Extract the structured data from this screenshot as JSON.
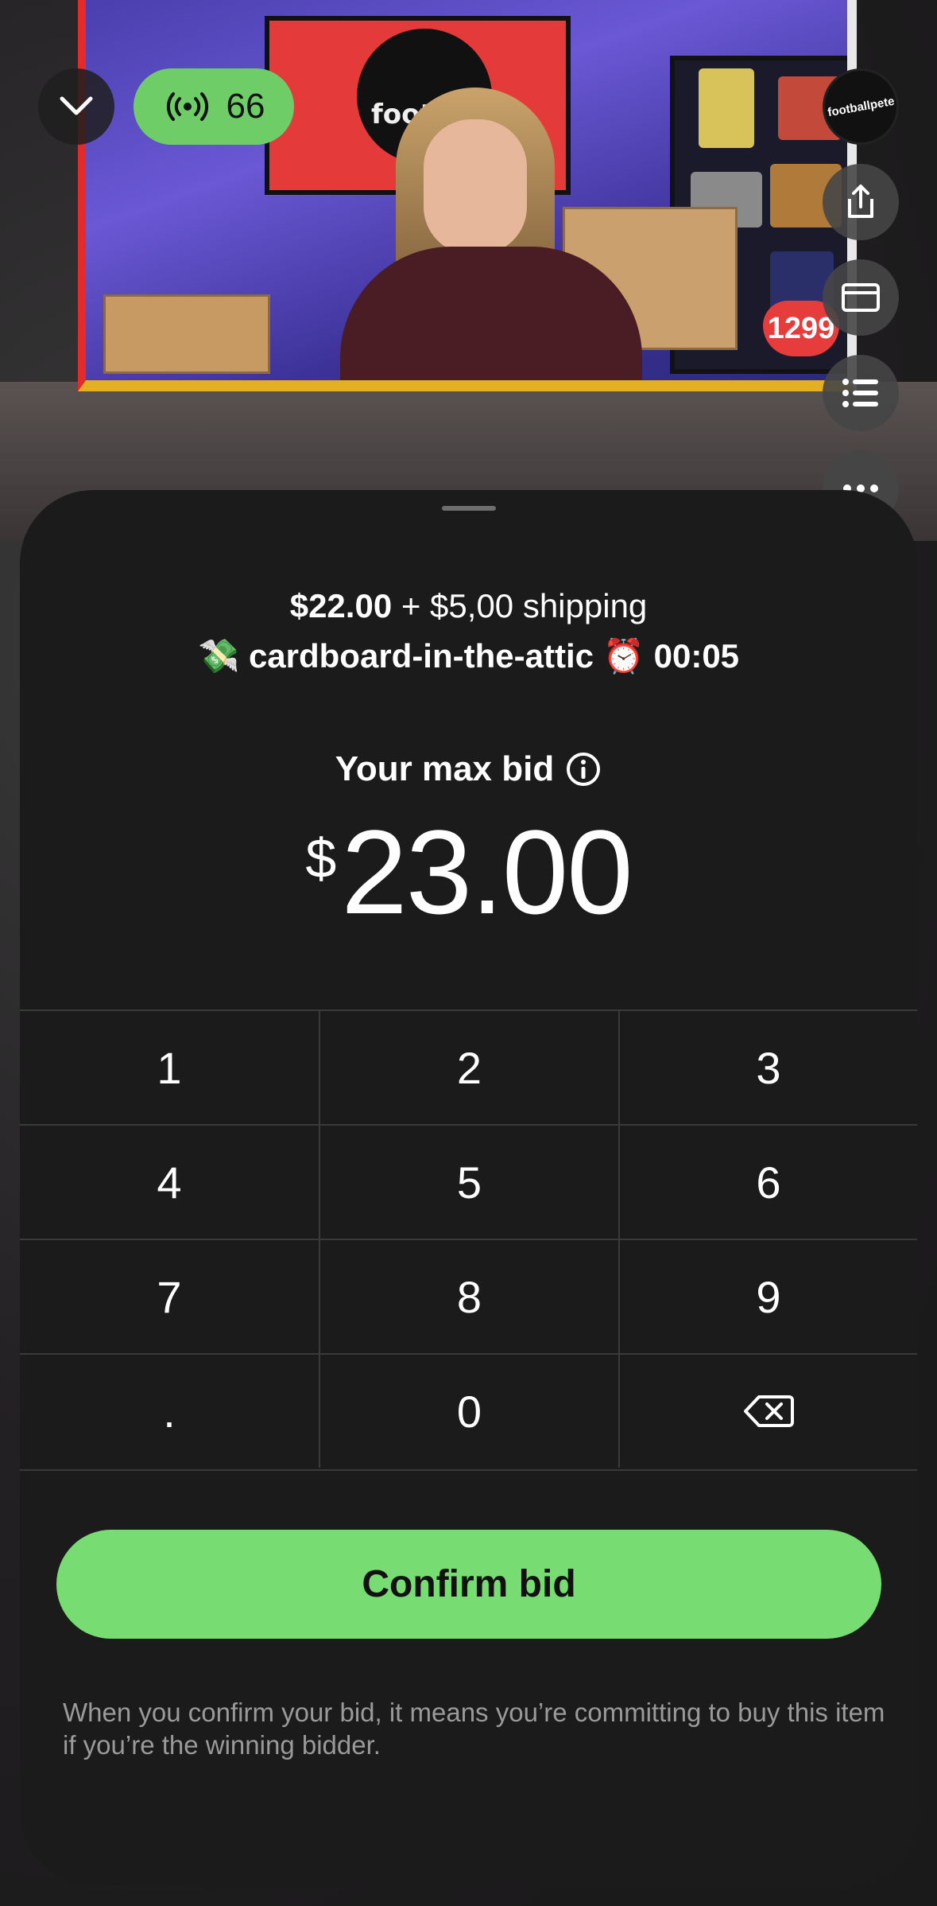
{
  "stream": {
    "viewer_count": "66",
    "sign_text": "footba",
    "heart_count": "1299",
    "host_avatar_text": "footballpete"
  },
  "side_rail": {
    "icons": [
      "share-icon",
      "card-icon",
      "list-icon",
      "more-icon"
    ]
  },
  "bid_sheet": {
    "price": "$22.00",
    "shipping": "+ $5,00 shipping",
    "seller_emoji": "💸",
    "seller": "cardboard-in-the-attic",
    "timer_emoji": "⏰",
    "timer": "00:05",
    "max_bid_label": "Your max bid",
    "currency_symbol": "$",
    "bid_amount": "23.00",
    "keypad": {
      "k1": "1",
      "k2": "2",
      "k3": "3",
      "k4": "4",
      "k5": "5",
      "k6": "6",
      "k7": "7",
      "k8": "8",
      "k9": "9",
      "kdot": ".",
      "k0": "0"
    },
    "confirm_label": "Confirm bid",
    "disclaimer": "When you confirm your bid, it means you’re committing to buy this item if you’re the winning bidder."
  },
  "colors": {
    "accent_green": "#77dc72",
    "live_pill_green": "#6fcd68",
    "sheet_bg": "#1b1b1b",
    "muted_text": "#9a9a9a"
  }
}
